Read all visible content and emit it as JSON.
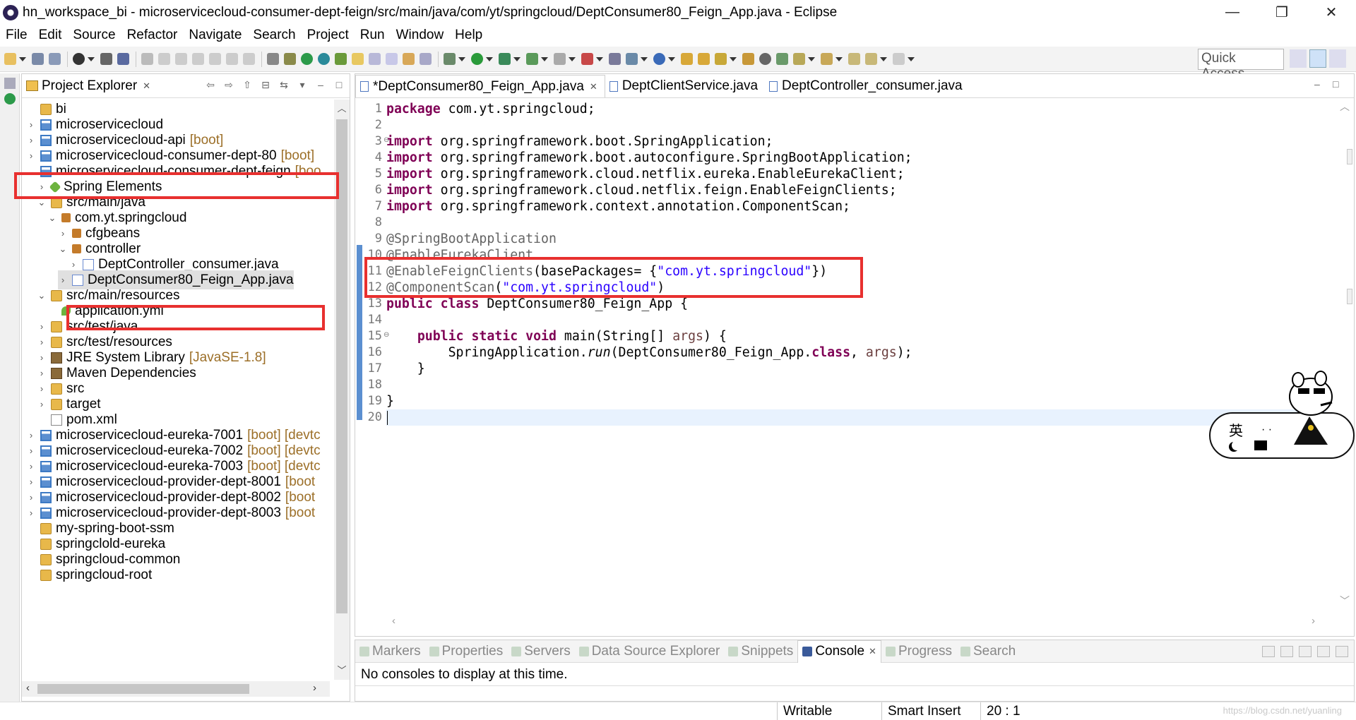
{
  "window": {
    "title": "hn_workspace_bi - microservicecloud-consumer-dept-feign/src/main/java/com/yt/springcloud/DeptConsumer80_Feign_App.java - Eclipse",
    "minimize": "—",
    "restore": "❐",
    "close": "✕"
  },
  "menu": [
    "File",
    "Edit",
    "Source",
    "Refactor",
    "Navigate",
    "Search",
    "Project",
    "Run",
    "Window",
    "Help"
  ],
  "toolbar": {
    "quick_access": "Quick Access"
  },
  "project_explorer": {
    "title": "Project Explorer",
    "close": "✕",
    "rows": [
      {
        "label": "bi",
        "dec": "",
        "icon": "folder-icon",
        "arrow": ""
      },
      {
        "label": "microservicecloud",
        "dec": "",
        "icon": "project-icon",
        "arrow": "›"
      },
      {
        "label": "microservicecloud-api",
        "dec": "[boot]",
        "icon": "project-icon",
        "arrow": "›"
      },
      {
        "label": "microservicecloud-consumer-dept-80",
        "dec": "[boot]",
        "icon": "project-icon",
        "arrow": "›"
      },
      {
        "label": "microservicecloud-consumer-dept-feign",
        "dec": "[boo",
        "icon": "project-icon",
        "arrow": "⌄"
      },
      {
        "label": "Spring Elements",
        "dec": "",
        "icon": "spring-icon",
        "arrow": "›"
      },
      {
        "label": "src/main/java",
        "dec": "",
        "icon": "source-folder-icon",
        "arrow": "⌄"
      },
      {
        "label": "com.yt.springcloud",
        "dec": "",
        "icon": "package-icon",
        "arrow": "⌄"
      },
      {
        "label": "cfgbeans",
        "dec": "",
        "icon": "package-icon",
        "arrow": "›"
      },
      {
        "label": "controller",
        "dec": "",
        "icon": "package-icon",
        "arrow": "⌄"
      },
      {
        "label": "DeptController_consumer.java",
        "dec": "",
        "icon": "java-file-icon",
        "arrow": "›"
      },
      {
        "label": "DeptConsumer80_Feign_App.java",
        "dec": "",
        "icon": "java-file-icon",
        "arrow": "›"
      },
      {
        "label": "src/main/resources",
        "dec": "",
        "icon": "source-folder-icon",
        "arrow": "⌄"
      },
      {
        "label": "application.yml",
        "dec": "",
        "icon": "yml-file-icon",
        "arrow": ""
      },
      {
        "label": "src/test/java",
        "dec": "",
        "icon": "source-folder-icon",
        "arrow": "›"
      },
      {
        "label": "src/test/resources",
        "dec": "",
        "icon": "source-folder-icon",
        "arrow": "›"
      },
      {
        "label": "JRE System Library",
        "dec": "[JavaSE-1.8]",
        "icon": "library-icon",
        "arrow": "›"
      },
      {
        "label": "Maven Dependencies",
        "dec": "",
        "icon": "library-icon",
        "arrow": "›"
      },
      {
        "label": "src",
        "dec": "",
        "icon": "folder-icon",
        "arrow": "›"
      },
      {
        "label": "target",
        "dec": "",
        "icon": "folder-icon",
        "arrow": "›"
      },
      {
        "label": "pom.xml",
        "dec": "",
        "icon": "xml-file-icon",
        "arrow": ""
      },
      {
        "label": "microservicecloud-eureka-7001",
        "dec": "[boot] [devtc",
        "icon": "project-icon",
        "arrow": "›"
      },
      {
        "label": "microservicecloud-eureka-7002",
        "dec": "[boot] [devtc",
        "icon": "project-icon",
        "arrow": "›"
      },
      {
        "label": "microservicecloud-eureka-7003",
        "dec": "[boot] [devtc",
        "icon": "project-icon",
        "arrow": "›"
      },
      {
        "label": "microservicecloud-provider-dept-8001",
        "dec": "[boot",
        "icon": "project-icon",
        "arrow": "›"
      },
      {
        "label": "microservicecloud-provider-dept-8002",
        "dec": "[boot",
        "icon": "project-icon",
        "arrow": "›"
      },
      {
        "label": "microservicecloud-provider-dept-8003",
        "dec": "[boot",
        "icon": "project-icon",
        "arrow": "›"
      },
      {
        "label": "my-spring-boot-ssm",
        "dec": "",
        "icon": "folder-icon",
        "arrow": ""
      },
      {
        "label": "springclold-eureka",
        "dec": "",
        "icon": "folder-icon",
        "arrow": ""
      },
      {
        "label": "springcloud-common",
        "dec": "",
        "icon": "folder-icon",
        "arrow": ""
      },
      {
        "label": "springcloud-root",
        "dec": "",
        "icon": "folder-icon",
        "arrow": ""
      }
    ],
    "selected_row": 11
  },
  "editor": {
    "tabs": [
      {
        "label": "*DeptConsumer80_Feign_App.java",
        "close": "✕",
        "active": true
      },
      {
        "label": "DeptClientService.java",
        "close": "",
        "active": false
      },
      {
        "label": "DeptController_consumer.java",
        "close": "",
        "active": false
      }
    ],
    "lines": [
      {
        "n": "1",
        "parts": [
          [
            "kw",
            "package"
          ],
          [
            "",
            " com.yt.springcloud;"
          ]
        ]
      },
      {
        "n": "2",
        "parts": []
      },
      {
        "n": "3",
        "fold": "⊖",
        "parts": [
          [
            "kw",
            "import"
          ],
          [
            "",
            " org.springframework.boot.SpringApplication;"
          ]
        ]
      },
      {
        "n": "4",
        "parts": [
          [
            "kw",
            "import"
          ],
          [
            "",
            " org.springframework.boot.autoconfigure.SpringBootApplication;"
          ]
        ]
      },
      {
        "n": "5",
        "parts": [
          [
            "kw",
            "import"
          ],
          [
            "",
            " org.springframework.cloud.netflix.eureka.EnableEurekaClient;"
          ]
        ]
      },
      {
        "n": "6",
        "parts": [
          [
            "kw",
            "import"
          ],
          [
            "",
            " org.springframework.cloud.netflix.feign.EnableFeignClients;"
          ]
        ]
      },
      {
        "n": "7",
        "parts": [
          [
            "kw",
            "import"
          ],
          [
            "",
            " org.springframework.context.annotation.ComponentScan;"
          ]
        ]
      },
      {
        "n": "8",
        "parts": []
      },
      {
        "n": "9",
        "parts": [
          [
            "ann",
            "@SpringBootApplication"
          ]
        ]
      },
      {
        "n": "10",
        "parts": [
          [
            "ann",
            "@EnableEurekaClient"
          ]
        ]
      },
      {
        "n": "11",
        "parts": [
          [
            "ann",
            "@EnableFeignClients"
          ],
          [
            "",
            "(basePackages= {"
          ],
          [
            "str",
            "\"com.yt.springcloud\""
          ],
          [
            "",
            "})"
          ]
        ]
      },
      {
        "n": "12",
        "parts": [
          [
            "ann",
            "@ComponentScan"
          ],
          [
            "",
            "("
          ],
          [
            "str",
            "\"com.yt.springcloud\""
          ],
          [
            "",
            ")"
          ]
        ]
      },
      {
        "n": "13",
        "parts": [
          [
            "kw",
            "public"
          ],
          [
            "",
            " "
          ],
          [
            "kw",
            "class"
          ],
          [
            "",
            " DeptConsumer80_Feign_App {"
          ]
        ]
      },
      {
        "n": "14",
        "parts": []
      },
      {
        "n": "15",
        "fold": "⊖",
        "parts": [
          [
            "",
            "    "
          ],
          [
            "kw",
            "public"
          ],
          [
            "",
            " "
          ],
          [
            "kw",
            "static"
          ],
          [
            "",
            " "
          ],
          [
            "kw",
            "void"
          ],
          [
            "",
            " main(String[] "
          ],
          [
            "var",
            "args"
          ],
          [
            "",
            ") {"
          ]
        ]
      },
      {
        "n": "16",
        "parts": [
          [
            "",
            "        SpringApplication."
          ],
          [
            "it",
            "run"
          ],
          [
            "",
            "(DeptConsumer80_Feign_App."
          ],
          [
            "kw",
            "class"
          ],
          [
            "",
            ", "
          ],
          [
            "var",
            "args"
          ],
          [
            "",
            ");"
          ]
        ]
      },
      {
        "n": "17",
        "parts": [
          [
            "",
            "    }"
          ]
        ]
      },
      {
        "n": "18",
        "parts": []
      },
      {
        "n": "19",
        "parts": [
          [
            "",
            "}"
          ]
        ]
      },
      {
        "n": "20",
        "parts": []
      }
    ],
    "current_line": 20
  },
  "bottom_panel": {
    "tabs": [
      {
        "label": "Markers",
        "active": false,
        "close": ""
      },
      {
        "label": "Properties",
        "active": false,
        "close": ""
      },
      {
        "label": "Servers",
        "active": false,
        "close": ""
      },
      {
        "label": "Data Source Explorer",
        "active": false,
        "close": ""
      },
      {
        "label": "Snippets",
        "active": false,
        "close": ""
      },
      {
        "label": "Console",
        "active": true,
        "close": "✕"
      },
      {
        "label": "Progress",
        "active": false,
        "close": ""
      },
      {
        "label": "Search",
        "active": false,
        "close": ""
      }
    ],
    "message": "No consoles to display at this time."
  },
  "status": {
    "writable": "Writable",
    "insert_mode": "Smart Insert",
    "position": "20 : 1",
    "watermark": "https://blog.csdn.net/yuanling"
  },
  "ime": {
    "language": "英",
    "dots": "· ·"
  },
  "colors": {
    "highlight": "#e8302f",
    "keyword": "#7f0055",
    "annotation": "#646464",
    "string": "#2a00ff"
  }
}
